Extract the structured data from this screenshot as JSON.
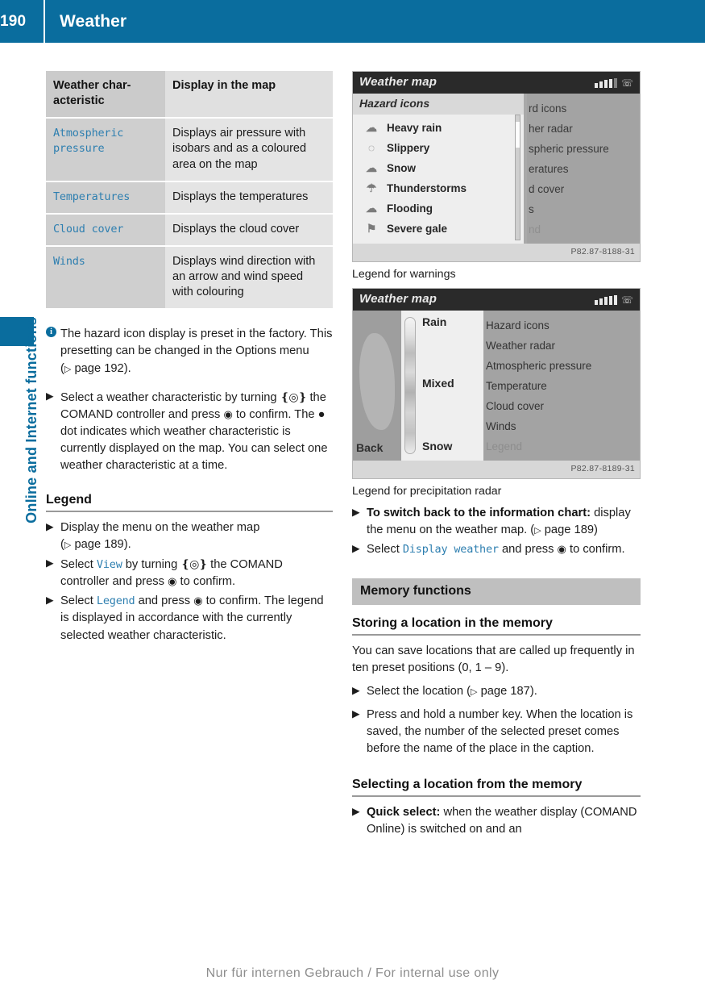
{
  "header": {
    "page_number": "190",
    "title": "Weather"
  },
  "side_tab": {
    "label": "Online and Internet functions"
  },
  "table": {
    "columns": [
      "Weather characteristic",
      "Display in the map"
    ],
    "header_key_line1": "Weather char-",
    "header_key_line2": "acteristic",
    "header_val": "Display in the map",
    "rows": [
      {
        "key": "Atmospheric pressure",
        "value": "Displays air pressure with isobars and as a coloured area on the map"
      },
      {
        "key": "Temperatures",
        "value": "Displays the temperatures"
      },
      {
        "key": "Cloud cover",
        "value": "Displays the cloud cover"
      },
      {
        "key": "Winds",
        "value": "Displays wind direction with an arrow and wind speed with colouring"
      }
    ]
  },
  "left_column": {
    "note": {
      "icon": "info-icon",
      "text_a": "The hazard icon display is preset in the factory. This presetting can be changed in the Options menu (",
      "ref": "page 192",
      "text_b": ")."
    },
    "step_select_characteristic": {
      "marker": "▶",
      "text_a": "Select a weather characteristic by turning",
      "glyph_turn": "❴◎❵",
      "text_b": "the COMAND controller and press",
      "glyph_press": "◉",
      "text_c": "to confirm.",
      "sub": "The ● dot indicates which weather characteristic is currently displayed on the map. You can select one weather characteristic at a time."
    },
    "legend_heading": "Legend",
    "legend_steps": [
      {
        "marker": "▶",
        "text_a": "Display the menu on the weather map (",
        "ref": "page 189",
        "text_b": ")."
      },
      {
        "marker": "▶",
        "text_a": "Select",
        "keyword": "View",
        "text_b": "by turning",
        "glyph_turn": "❴◎❵",
        "text_c": "the COMAND controller and press",
        "glyph_press": "◉",
        "text_d": "to confirm."
      },
      {
        "marker": "▶",
        "text_a": "Select",
        "keyword": "Legend",
        "text_b": "and press",
        "glyph_press": "◉",
        "text_c": "to confirm.",
        "sub": "The legend is displayed in accordance with the currently selected weather characteristic."
      }
    ]
  },
  "screenshot_warnings": {
    "caption": "Legend for warnings",
    "status_title": "Weather map",
    "signal_bars": 5,
    "panel_title": "Hazard icons",
    "items": [
      {
        "icon": "heavy-rain-icon",
        "glyph": "☁",
        "label": "Heavy rain"
      },
      {
        "icon": "slippery-icon",
        "glyph": "◌",
        "label": "Slippery"
      },
      {
        "icon": "snow-icon",
        "glyph": "☁",
        "label": "Snow"
      },
      {
        "icon": "thunderstorm-icon",
        "glyph": "☂",
        "label": "Thunderstorms"
      },
      {
        "icon": "flooding-icon",
        "glyph": "☁",
        "label": "Flooding"
      },
      {
        "icon": "severe-gale-icon",
        "glyph": "⚑",
        "label": "Severe gale"
      }
    ],
    "background_menu": [
      "rd icons",
      "her radar",
      "spheric pressure",
      "eratures",
      "d cover",
      "s",
      "nd"
    ],
    "image_code": "P82.87-8188-31"
  },
  "screenshot_radar": {
    "caption": "Legend for precipitation radar",
    "status_title": "Weather map",
    "signal_bars": 5,
    "back_label": "Back",
    "scale_labels": [
      "Rain",
      "Mixed",
      "Snow"
    ],
    "menu": [
      "Hazard icons",
      "Weather radar",
      "Atmospheric pressure",
      "Temperature",
      "Cloud cover",
      "Winds",
      "Legend"
    ],
    "image_code": "P82.87-8189-31"
  },
  "right_column": {
    "switch_back_step": {
      "marker": "▶",
      "bold": "To switch back to the information chart:",
      "text_a": "display the menu on the weather map. (",
      "ref": "page 189",
      "text_b": ")"
    },
    "display_weather_step": {
      "marker": "▶",
      "text_a": "Select",
      "keyword": "Display weather",
      "text_b": "and press",
      "glyph_press": "◉",
      "text_c": "to confirm."
    },
    "band_title": "Memory functions",
    "storing_heading": "Storing a location in the memory",
    "storing_body": "You can save locations that are called up frequently in ten preset positions (0, 1 – 9).",
    "storing_steps": [
      {
        "marker": "▶",
        "text_a": "Select the location (",
        "ref": "page 187",
        "text_b": ")."
      },
      {
        "marker": "▶",
        "text_a": "Press and hold a number key.",
        "sub": "When the location is saved, the number of the selected preset comes before the name of the place in the caption."
      }
    ],
    "selecting_heading": "Selecting a location from the memory",
    "selecting_step": {
      "marker": "▶",
      "bold": "Quick select:",
      "text_a": "when the weather display (COMAND Online) is switched on and an"
    }
  },
  "footer": {
    "text": "Nur für internen Gebrauch / For internal use only"
  },
  "colors": {
    "brand_blue": "#0a6d9e",
    "keyword_blue": "#2e7fb0",
    "table_key_bg": "#cfcfcf",
    "table_value_bg": "#e4e4e4",
    "band_bg": "#bfbfbf"
  }
}
